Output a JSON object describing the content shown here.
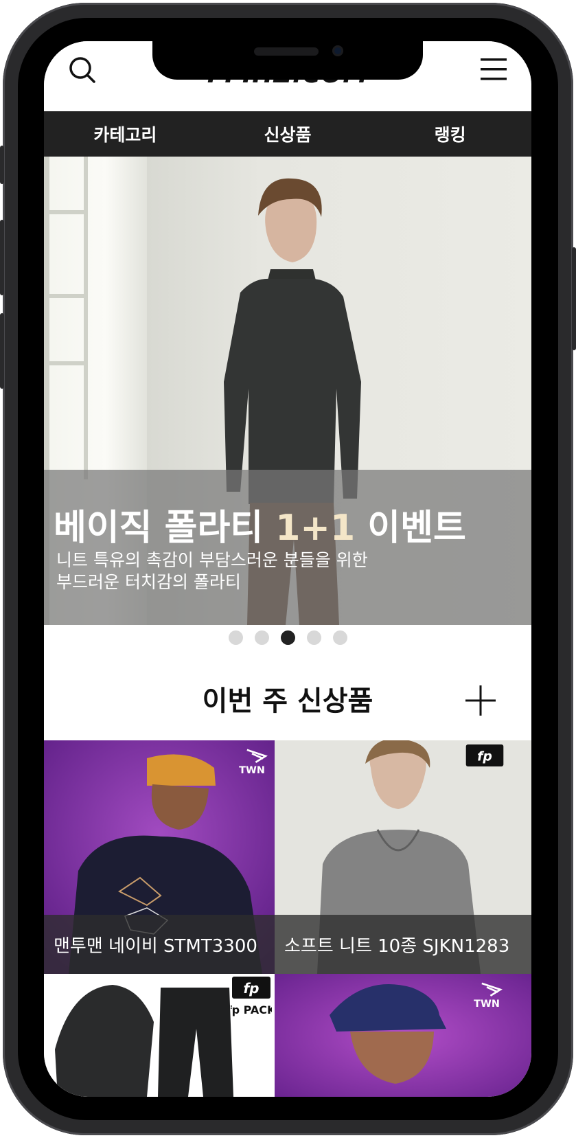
{
  "header": {
    "logo_text": "FFIHZ.COM",
    "search_icon": "search-icon",
    "menu_icon": "hamburger-menu-icon"
  },
  "nav": {
    "items": [
      {
        "label": "카테고리"
      },
      {
        "label": "신상품"
      },
      {
        "label": "랭킹"
      }
    ]
  },
  "hero": {
    "title_before": "베이직 폴라티 ",
    "title_accent": "1+1",
    "title_after": " 이벤트",
    "subtitle_line1": "니트 특유의 촉감이 부담스러운 분들을 위한",
    "subtitle_line2": "부드러운 터치감의 폴라티",
    "slides_total": 5,
    "active_slide": 3
  },
  "section": {
    "title": "이번 주 신상품",
    "more_icon": "plus-icon"
  },
  "products": [
    {
      "name": "맨투맨 네이비 STMT3300",
      "badge": "TWN"
    },
    {
      "name": "소프트 니트 10종 SJKN1283",
      "badge": "fp"
    },
    {
      "name": "",
      "badge": "fp PACK"
    },
    {
      "name": "",
      "badge": "TWN"
    }
  ],
  "colors": {
    "nav_bg": "#222222",
    "accent_text": "#f4e6c8",
    "dot_active": "#222222",
    "dot_inactive": "#d8d8d8",
    "purple_bg": "#7a2a9c"
  }
}
